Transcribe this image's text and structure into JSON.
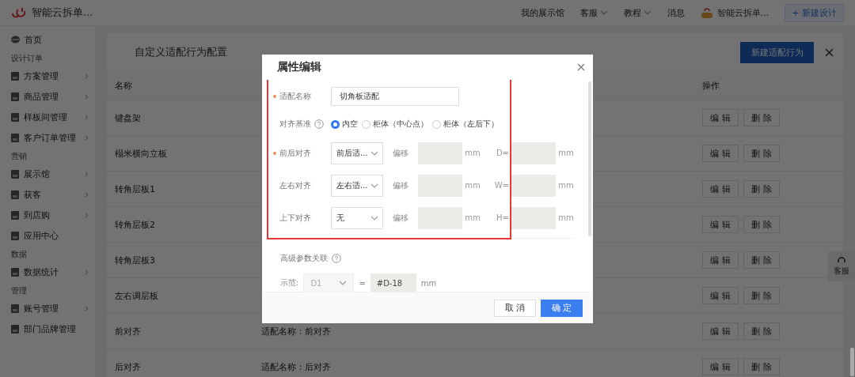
{
  "header": {
    "app_name": "智能云拆单...",
    "nav": [
      {
        "label": "我的展示馆",
        "dropdown": false
      },
      {
        "label": "客服",
        "dropdown": true
      },
      {
        "label": "教程",
        "dropdown": true
      },
      {
        "label": "消息",
        "dropdown": false
      }
    ],
    "account": "智能云拆单...",
    "new_design": "+ 新建设计"
  },
  "sidebar": {
    "items": [
      {
        "kind": "item",
        "label": "首页",
        "arrow": false
      },
      {
        "kind": "section",
        "label": "设计订单"
      },
      {
        "kind": "item",
        "label": "方案管理",
        "arrow": true
      },
      {
        "kind": "item",
        "label": "商品管理",
        "arrow": true
      },
      {
        "kind": "item",
        "label": "样板间管理",
        "arrow": true
      },
      {
        "kind": "item",
        "label": "客户订单管理",
        "arrow": true
      },
      {
        "kind": "section",
        "label": "营销"
      },
      {
        "kind": "item",
        "label": "展示馆",
        "arrow": true
      },
      {
        "kind": "item",
        "label": "获客",
        "arrow": true
      },
      {
        "kind": "item",
        "label": "到店购",
        "arrow": true
      },
      {
        "kind": "item",
        "label": "应用中心",
        "arrow": false
      },
      {
        "kind": "section",
        "label": "数据"
      },
      {
        "kind": "item",
        "label": "数据统计",
        "arrow": true
      },
      {
        "kind": "section",
        "label": "管理"
      },
      {
        "kind": "item",
        "label": "账号管理",
        "arrow": true
      },
      {
        "kind": "item",
        "label": "部门品牌管理",
        "arrow": false
      }
    ]
  },
  "page": {
    "title": "自定义适配行为配置",
    "new_button": "新建适配行为",
    "table": {
      "columns": [
        "名称",
        "操作"
      ],
      "rows": [
        {
          "name": "键盘架",
          "actions": [
            "编 辑",
            "删 除"
          ]
        },
        {
          "name": "榻米横向立板",
          "actions": [
            "编 辑",
            "删 除"
          ]
        },
        {
          "name": "转角层板1",
          "actions": [
            "编 辑",
            "删 除"
          ]
        },
        {
          "name": "转角层板2",
          "actions": [
            "编 辑",
            "删 除"
          ]
        },
        {
          "name": "转角层板3",
          "actions": [
            "编 辑",
            "删 除"
          ]
        },
        {
          "name": "左右调层板",
          "actions": [
            "编 辑",
            "删 除"
          ]
        },
        {
          "name": "前对齐",
          "column_2": "适配名称：前对齐",
          "actions": [
            "编 辑",
            "删 除"
          ]
        },
        {
          "name": "后对齐",
          "column_2": "适配名称：后对齐",
          "actions": [
            "编 辑",
            "删 除"
          ]
        }
      ]
    }
  },
  "float_service": "客服",
  "dialog": {
    "title": "属性编辑",
    "fields": [
      {
        "kind": "text",
        "label": "适配名称",
        "required": true,
        "help": false,
        "value": "切角板适配"
      },
      {
        "kind": "radio",
        "label": "对齐基准",
        "required": false,
        "help": true,
        "options": [
          {
            "label": "内空",
            "selected": true
          },
          {
            "label": "柜体（中心点）",
            "selected": false
          },
          {
            "label": "柜体（左后下）",
            "selected": false
          }
        ]
      },
      {
        "kind": "align",
        "label": "前后对齐",
        "required": true,
        "help": false,
        "select": "前后适...",
        "offset_label": "偏移",
        "offset_unit": "mm",
        "size_label": "D=",
        "size_unit": "mm"
      },
      {
        "kind": "align",
        "label": "左右对齐",
        "required": false,
        "help": false,
        "select": "左右适...",
        "offset_label": "偏移",
        "offset_unit": "mm",
        "size_label": "W=",
        "size_unit": "mm"
      },
      {
        "kind": "align",
        "label": "上下对齐",
        "required": false,
        "help": false,
        "select": "无",
        "offset_label": "偏移",
        "offset_unit": "mm",
        "size_label": "H=",
        "size_unit": "mm"
      }
    ],
    "advanced": {
      "label": "高级参数关联",
      "example_label": "示范:",
      "select": "D1",
      "equals": "=",
      "value": "#D-18",
      "unit": "mm"
    },
    "buttons": [
      {
        "label": "取 消",
        "kind": "default"
      },
      {
        "label": "确 定",
        "kind": "primary"
      }
    ]
  }
}
